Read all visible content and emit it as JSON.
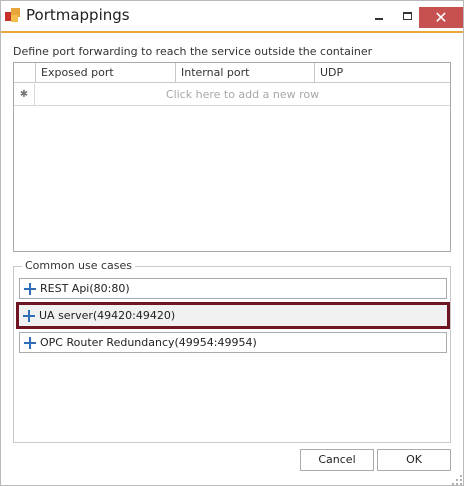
{
  "window": {
    "title": "Portmappings",
    "accent_color": "#e8a53a",
    "close_color": "#c75050",
    "close_glyph": "✕"
  },
  "description": "Define port forwarding to reach the service outside the container",
  "grid": {
    "columns": [
      "Exposed port",
      "Internal port",
      "UDP"
    ],
    "new_row_indicator": "✱",
    "new_row_hint": "Click here to add a new row"
  },
  "common": {
    "title": "Common use cases",
    "selected_border_color": "#6e1422",
    "icon": "plus-icon",
    "items": [
      {
        "label": "REST Api(80:80)"
      },
      {
        "label": "UA server(49420:49420)"
      },
      {
        "label": "OPC Router Redundancy(49954:49954)"
      }
    ]
  },
  "buttons": {
    "cancel": "Cancel",
    "ok": "OK"
  }
}
